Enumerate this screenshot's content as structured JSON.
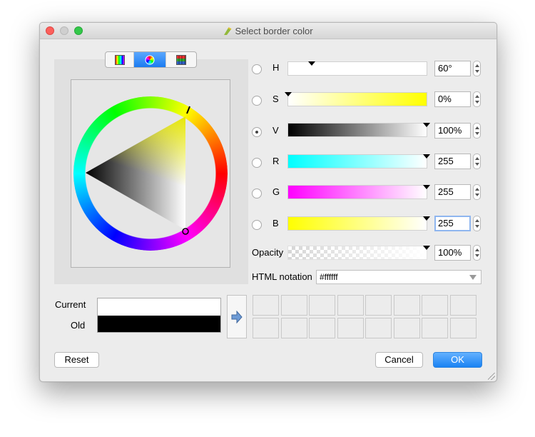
{
  "window": {
    "title": "Select border color"
  },
  "tabs": [
    {
      "name": "color-ramp",
      "active": false
    },
    {
      "name": "color-wheel",
      "active": true
    },
    {
      "name": "color-swatches",
      "active": false
    }
  ],
  "channels": [
    {
      "id": "h",
      "label": "H",
      "value": "60°",
      "selected": false,
      "colors": [
        "#ffffff",
        "#ffffff"
      ],
      "marker": 0.17
    },
    {
      "id": "s",
      "label": "S",
      "value": "0%",
      "selected": false,
      "colors": [
        "#ffffff",
        "#ffff00"
      ],
      "marker": 0.0
    },
    {
      "id": "v",
      "label": "V",
      "value": "100%",
      "selected": true,
      "colors": [
        "#000000",
        "#ffffff"
      ],
      "marker": 1.0
    },
    {
      "id": "r",
      "label": "R",
      "value": "255",
      "selected": false,
      "colors": [
        "#00ffff",
        "#ffffff"
      ],
      "marker": 1.0
    },
    {
      "id": "g",
      "label": "G",
      "value": "255",
      "selected": false,
      "colors": [
        "#ff00ff",
        "#ffffff"
      ],
      "marker": 1.0
    },
    {
      "id": "b",
      "label": "B",
      "value": "255",
      "selected": false,
      "colors": [
        "#ffff00",
        "#ffffff"
      ],
      "marker": 1.0,
      "focused": true
    }
  ],
  "opacity": {
    "label": "Opacity",
    "value": "100%",
    "marker": 1.0
  },
  "html_notation": {
    "label": "HTML notation",
    "value": "#ffffff"
  },
  "preview": {
    "current_label": "Current",
    "old_label": "Old",
    "current_color": "#ffffff",
    "old_color": "#000000"
  },
  "swatches": {
    "rows": 2,
    "cols": 8
  },
  "buttons": {
    "reset": "Reset",
    "cancel": "Cancel",
    "ok": "OK"
  },
  "colors": {
    "accent": "#1a82f3",
    "window_bg": "#ececec"
  }
}
